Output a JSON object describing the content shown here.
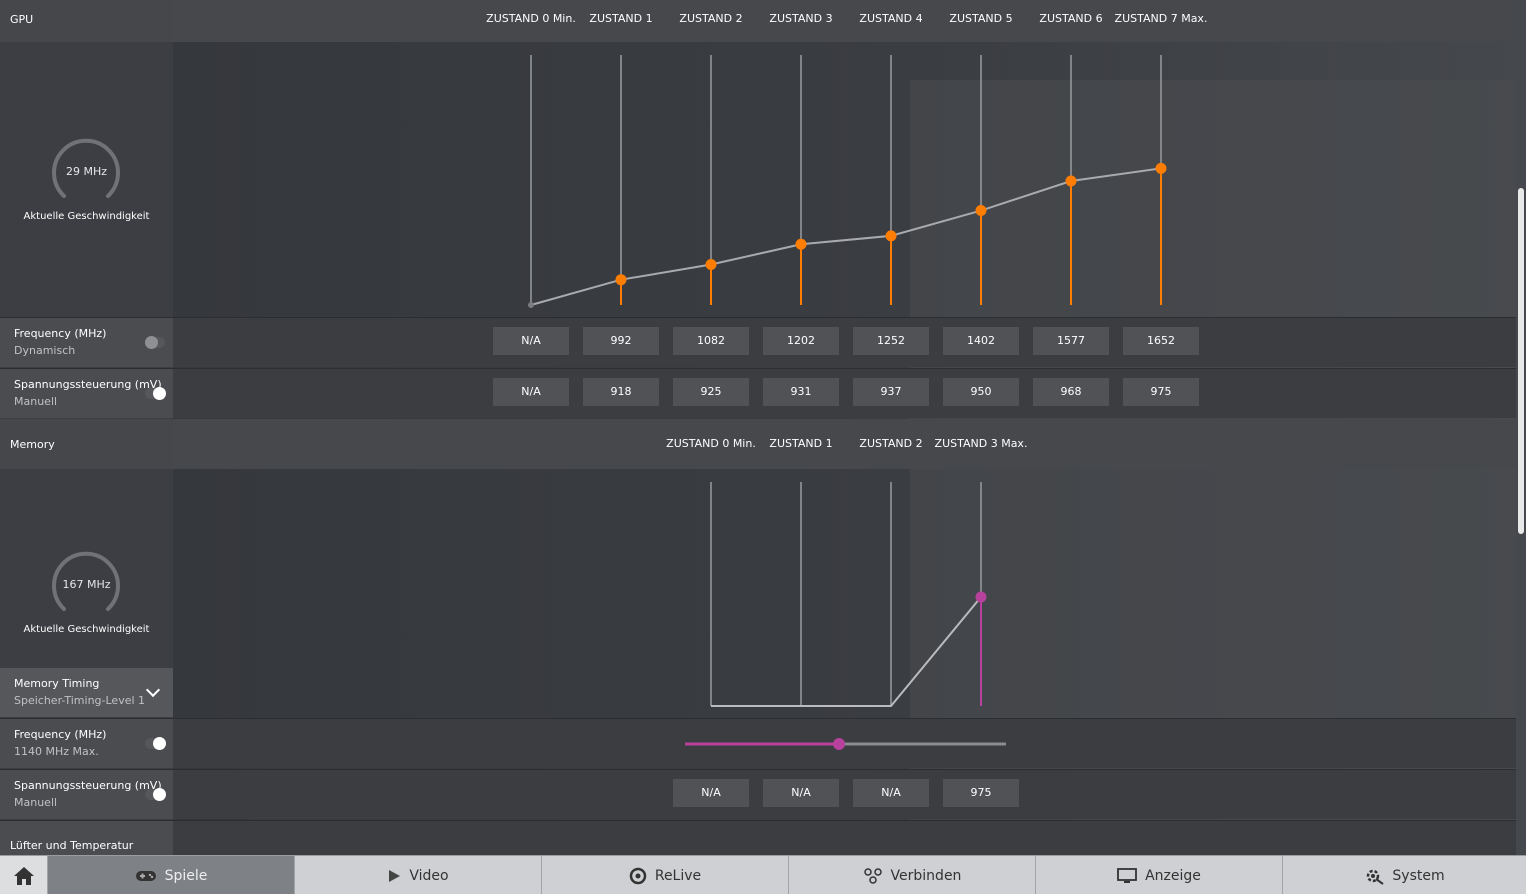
{
  "gpu": {
    "title": "GPU",
    "gauge_value": "29 MHz",
    "gauge_label": "Aktuelle Geschwindigkeit",
    "states": [
      "ZUSTAND 0 Min.",
      "ZUSTAND 1",
      "ZUSTAND 2",
      "ZUSTAND 3",
      "ZUSTAND 4",
      "ZUSTAND 5",
      "ZUSTAND 6",
      "ZUSTAND 7 Max."
    ],
    "frequency": {
      "label": "Frequency (MHz)",
      "mode": "Dynamisch",
      "toggle_on": false,
      "values": [
        "N/A",
        "992",
        "1082",
        "1202",
        "1252",
        "1402",
        "1577",
        "1652"
      ]
    },
    "voltage": {
      "label": "Spannungssteuerung (mV)",
      "mode": "Manuell",
      "toggle_on": true,
      "values": [
        "N/A",
        "918",
        "925",
        "931",
        "937",
        "950",
        "968",
        "975"
      ]
    }
  },
  "memory": {
    "title": "Memory",
    "gauge_value": "167 MHz",
    "gauge_label": "Aktuelle Geschwindigkeit",
    "states": [
      "ZUSTAND 0 Min.",
      "ZUSTAND 1",
      "ZUSTAND 2",
      "ZUSTAND 3 Max."
    ],
    "timing": {
      "label": "Memory Timing",
      "value": "Speicher-Timing-Level 1"
    },
    "frequency": {
      "label": "Frequency (MHz)",
      "mode": "1140 MHz Max.",
      "toggle_on": true,
      "slider_fraction": 0.48
    },
    "voltage": {
      "label": "Spannungssteuerung (mV)",
      "mode": "Manuell",
      "toggle_on": true,
      "values": [
        "N/A",
        "N/A",
        "N/A",
        "975"
      ]
    }
  },
  "fan_section": {
    "title": "Lüfter und Temperatur"
  },
  "taskbar": {
    "items": [
      {
        "label": "Spiele",
        "icon": "gamepad-icon"
      },
      {
        "label": "Video",
        "icon": "play-icon"
      },
      {
        "label": "ReLive",
        "icon": "relive-icon"
      },
      {
        "label": "Verbinden",
        "icon": "connect-icon"
      },
      {
        "label": "Anzeige",
        "icon": "monitor-icon"
      },
      {
        "label": "System",
        "icon": "gear-icon"
      }
    ],
    "home_icon": "home-icon"
  },
  "colors": {
    "gpu_accent": "#ff7d00",
    "memory_accent": "#b7419d"
  }
}
